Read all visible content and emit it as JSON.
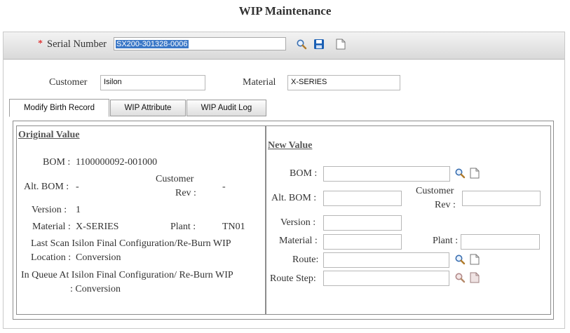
{
  "page": {
    "title": "WIP Maintenance"
  },
  "header": {
    "required_mark": "*",
    "serial_label": "Serial Number",
    "serial_value": "SX200-301328-0006",
    "icons": [
      "search-icon",
      "save-icon",
      "new-document-icon"
    ]
  },
  "customer": {
    "label": "Customer",
    "value": "Isilon"
  },
  "material": {
    "label": "Material",
    "value": "X-SERIES"
  },
  "tabs": [
    {
      "label": "Modify Birth Record",
      "active": true
    },
    {
      "label": "WIP Attribute",
      "active": false
    },
    {
      "label": "WIP Audit Log",
      "active": false
    }
  ],
  "original": {
    "heading": "Original Value",
    "bom_label": "BOM :",
    "bom_value": "1100000092-001000",
    "alt_bom_label": "Alt. BOM :",
    "alt_bom_value": "-",
    "customer_rev_label_1": "Customer",
    "customer_rev_label_2": "Rev :",
    "customer_rev_value": "-",
    "version_label": "Version :",
    "version_value": "1",
    "material_label": "Material :",
    "material_value": "X-SERIES",
    "plant_label": "Plant :",
    "plant_value": "TN01",
    "last_scan_line1": "Last Scan Isilon Final Configuration/Re-Burn WIP",
    "last_scan_line2_label": "Location :",
    "last_scan_line2_value": "Conversion",
    "in_queue_line1": "In Queue At Isilon Final Configuration/ Re-Burn WIP",
    "in_queue_line2": ": Conversion"
  },
  "new": {
    "heading": "New Value",
    "bom_label": "BOM :",
    "alt_bom_label": "Alt. BOM :",
    "customer_rev_label_1": "Customer",
    "customer_rev_label_2": "Rev :",
    "version_label": "Version :",
    "material_label": "Material :",
    "plant_label": "Plant :",
    "route_label": "Route:",
    "route_step_label": "Route Step:"
  },
  "colors": {
    "accent_selection": "#3b78c7",
    "save_icon": "#1a5fb4",
    "required": "#dd0000"
  }
}
